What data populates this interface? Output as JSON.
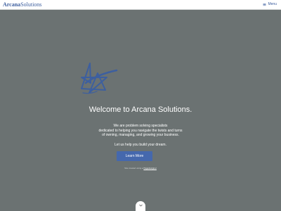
{
  "header": {
    "logo_part1": "Arcana",
    "logo_part2": "Solutions",
    "menu_label": "Menu",
    "menu_icon": "hamburger-icon"
  },
  "hero": {
    "logo_icon": "star-swoosh-icon",
    "headline": "Welcome to Arcana Solutions.",
    "intro_lines": [
      "We are problem solving specialists",
      "dedicated to helping you navigate the twists and turns",
      "of owning, managing, and growing your business."
    ],
    "tagline": "Let us help you build your dream.",
    "cta_label": "Learn More",
    "credit_prefix": "Site created using ▸",
    "credit_link": "Pagedesigner",
    "scroll_icon": "chevron-down-icon"
  },
  "colors": {
    "brand": "#3d5f9f",
    "cta": "#4568ad",
    "hero_bg": "#6b7272"
  }
}
